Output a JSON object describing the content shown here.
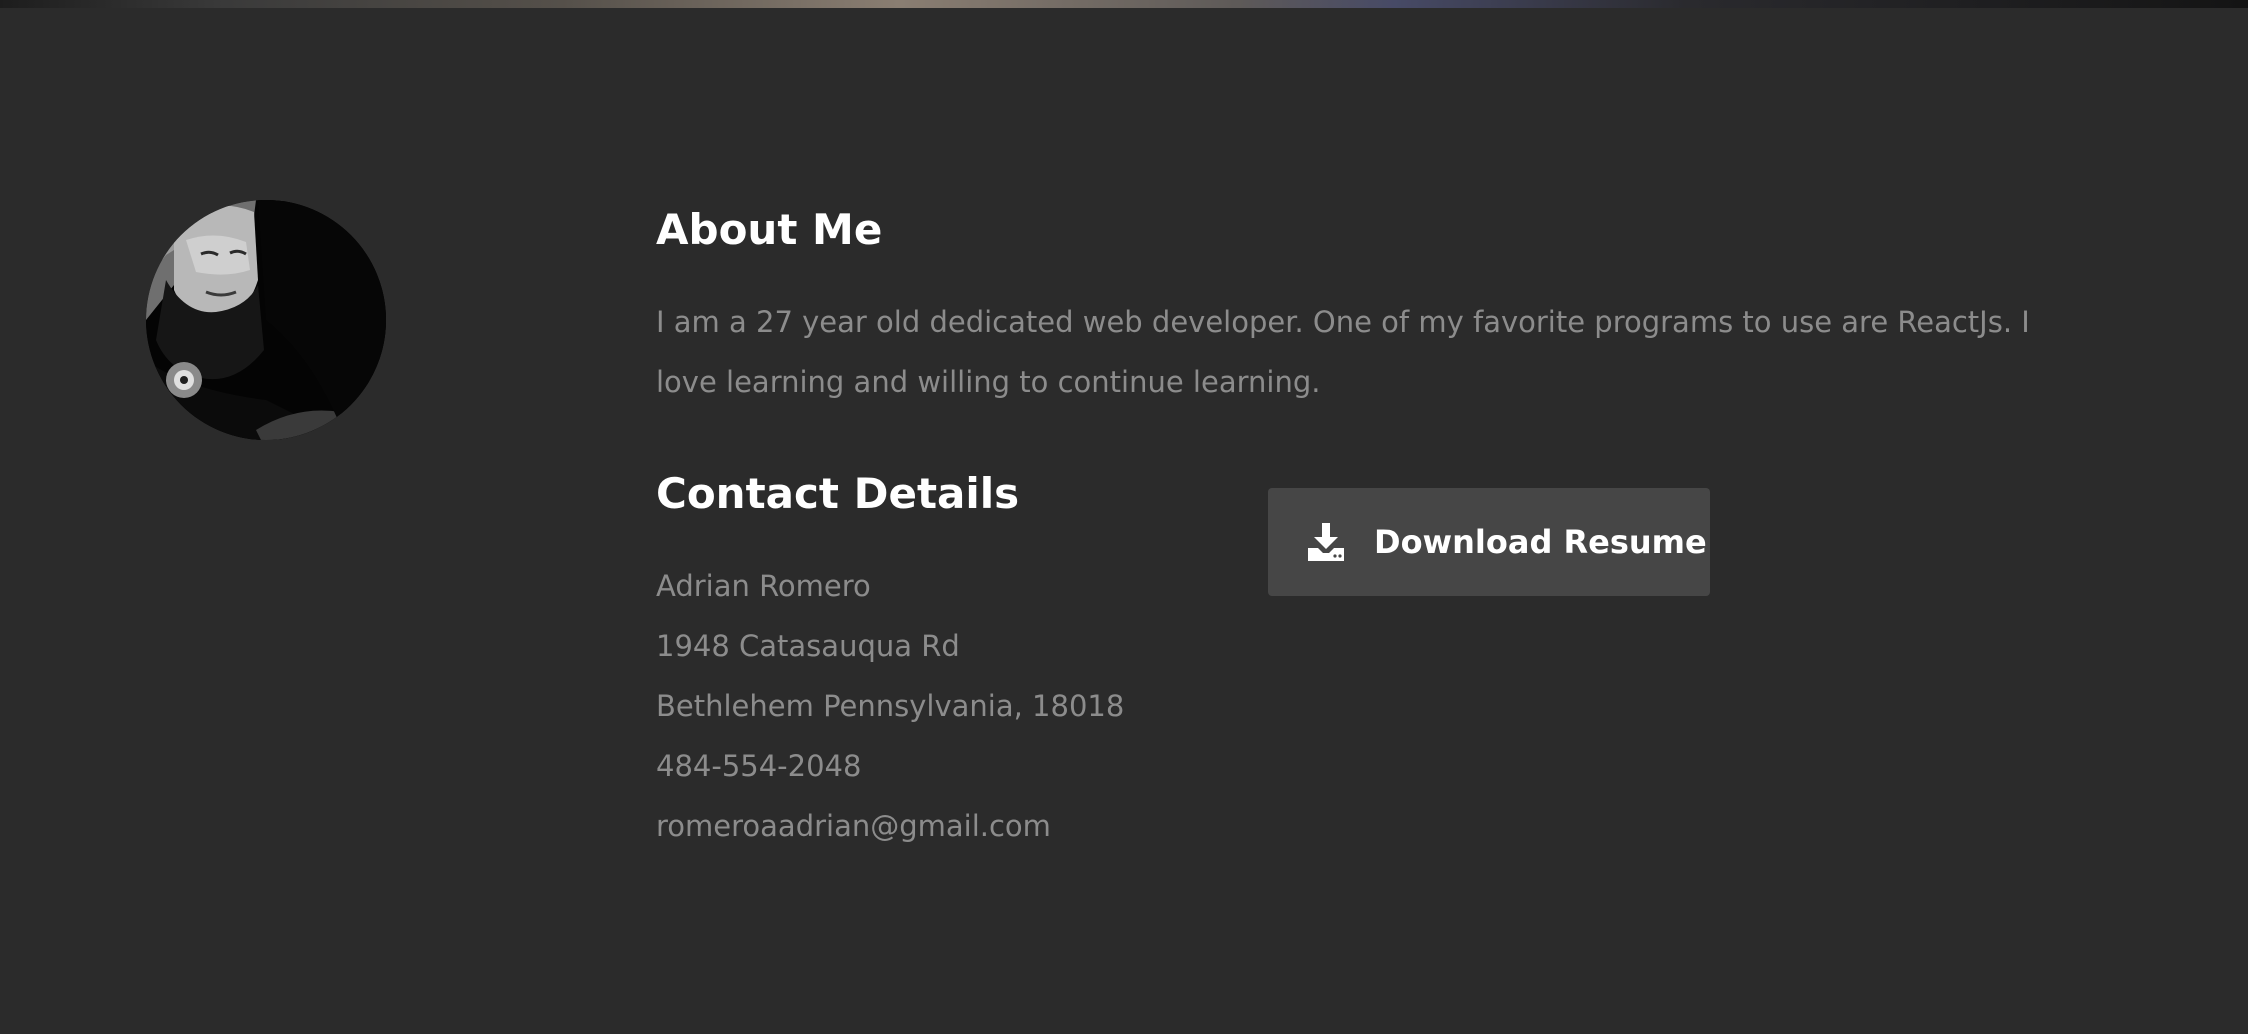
{
  "about": {
    "heading": "About Me",
    "text": "I am a 27 year old dedicated web developer. One of my favorite programs to use are ReactJs. I love learning and willing to continue learning."
  },
  "contact": {
    "heading": "Contact Details",
    "name": "Adrian Romero",
    "street": "1948 Catasauqua Rd",
    "city": "Bethlehem Pennsylvania, 18018",
    "phone": "484-554-2048",
    "email": "romeroaadrian@gmail.com"
  },
  "download": {
    "label": "Download Resume",
    "icon": "download-icon"
  },
  "profile": {
    "avatar": "profile-photo"
  },
  "colors": {
    "background": "#2b2b2b",
    "heading": "#ffffff",
    "body_text": "#8c8c8c",
    "button_bg": "#464646"
  }
}
